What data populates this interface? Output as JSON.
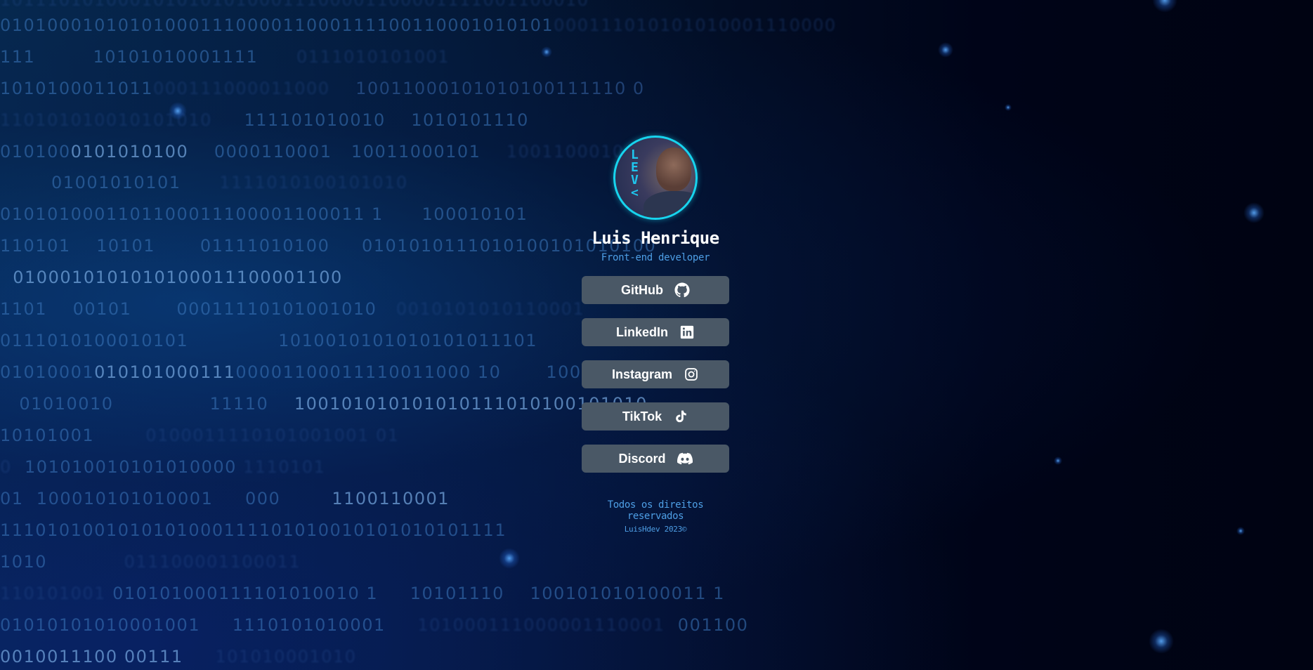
{
  "profile": {
    "name": "Luis Henrique",
    "role": "Front-end developer",
    "avatar_letters": [
      "L",
      "E",
      "V",
      "<"
    ]
  },
  "links": [
    {
      "label": "GitHub",
      "icon": "github-icon"
    },
    {
      "label": "LinkedIn",
      "icon": "linkedin-icon"
    },
    {
      "label": "Instagram",
      "icon": "instagram-icon"
    },
    {
      "label": "TikTok",
      "icon": "tiktok-icon"
    },
    {
      "label": "Discord",
      "icon": "discord-icon"
    }
  ],
  "footer": {
    "line1": "Todos os direitos reservados",
    "line2": "LuisHdev 2023©"
  },
  "colors": {
    "avatar_ring": "#17d4ee",
    "accent_text": "#4e9fe6",
    "button_bg": "#4a5866",
    "button_text": "#ffffff"
  }
}
